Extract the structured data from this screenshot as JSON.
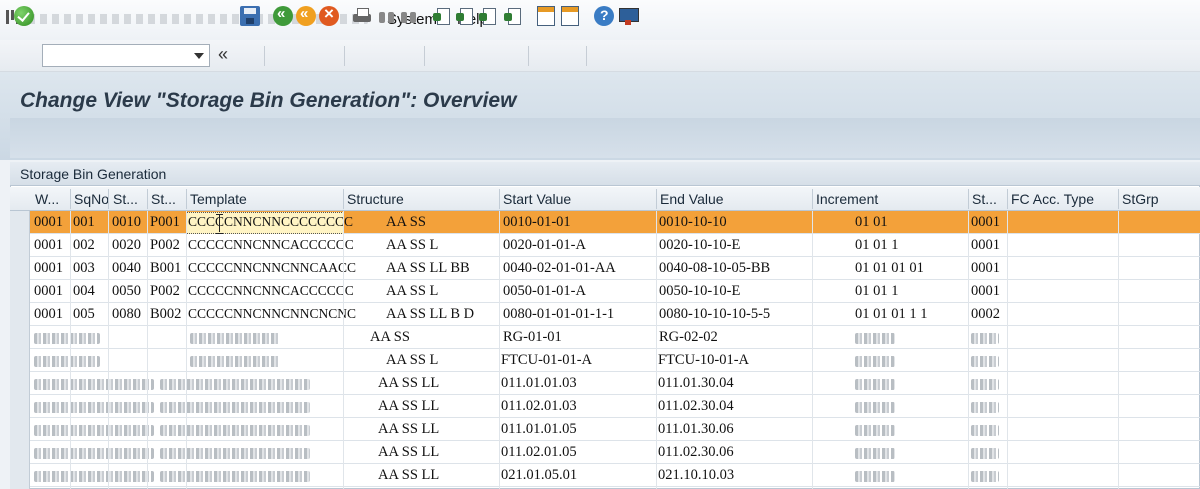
{
  "menu": {
    "items": [
      "System",
      "Help"
    ]
  },
  "toolbar": {
    "command_field_value": "",
    "guillemet": "«"
  },
  "page_title": "Change View \"Storage Bin Generation\": Overview",
  "table": {
    "caption": "Storage Bin Generation",
    "columns": [
      "W...",
      "SqNo",
      "St...",
      "St...",
      "Template",
      "Structure",
      "Start Value",
      "End Value",
      "Increment",
      "St...",
      "FC Acc. Type",
      "StGrp"
    ],
    "rows": [
      {
        "w": "0001",
        "sqno": "001",
        "st1": "0010",
        "st2": "P001",
        "template": "CCCCCNNCNNCCCCCCCC",
        "structure": "AA SS",
        "start": "0010-01-01",
        "end": "0010-10-10",
        "increment": "01 01",
        "st3": "0001"
      },
      {
        "w": "0001",
        "sqno": "002",
        "st1": "0020",
        "st2": "P002",
        "template": "CCCCCNNCNNCACCCCCC",
        "structure": "AA SS L",
        "start": "0020-01-01-A",
        "end": "0020-10-10-E",
        "increment": "01 01 1",
        "st3": "0001"
      },
      {
        "w": "0001",
        "sqno": "003",
        "st1": "0040",
        "st2": "B001",
        "template": "CCCCCNNCNNCNNCAACC",
        "structure": "AA SS LL BB",
        "start": "0040-02-01-01-AA",
        "end": "0040-08-10-05-BB",
        "increment": "01 01 01 01",
        "st3": "0001"
      },
      {
        "w": "0001",
        "sqno": "004",
        "st1": "0050",
        "st2": "P002",
        "template": "CCCCCNNCNNCACCCCCC",
        "structure": "AA SS L",
        "start": "0050-01-01-A",
        "end": "0050-10-10-E",
        "increment": "01 01 1",
        "st3": "0001"
      },
      {
        "w": "0001",
        "sqno": "005",
        "st1": "0080",
        "st2": "B002",
        "template": "CCCCCNNCNNCNNCNCNC",
        "structure": "AA SS LL B D",
        "start": "0080-01-01-01-1-1",
        "end": "0080-10-10-10-5-5",
        "increment": "01 01 01 1 1",
        "st3": "0002"
      },
      {
        "structure": "AA SS",
        "start": "RG-01-01",
        "end": "RG-02-02"
      },
      {
        "structure": "AA SS L",
        "start": "FTCU-01-01-A",
        "end": "FTCU-10-01-A"
      },
      {
        "structure": "AA SS LL",
        "start": "011.01.01.03",
        "end": "011.01.30.04"
      },
      {
        "structure": "AA SS LL",
        "start": "011.02.01.03",
        "end": "011.02.30.04"
      },
      {
        "structure": "AA SS LL",
        "start": "011.01.01.05",
        "end": "011.01.30.06"
      },
      {
        "structure": "AA SS LL",
        "start": "011.02.01.05",
        "end": "011.02.30.06"
      },
      {
        "structure": "AA SS LL",
        "start": "021.01.05.01",
        "end": "021.10.10.03"
      }
    ]
  },
  "colors": {
    "selected_row": "#f3a13a",
    "title_text": "#2b3a4a"
  }
}
